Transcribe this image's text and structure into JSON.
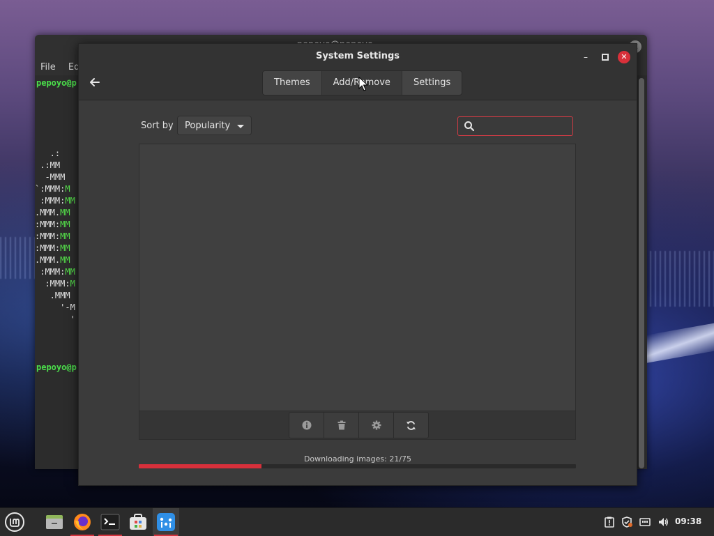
{
  "terminal": {
    "title": "pepoyo@pepoyo-...",
    "menu": [
      "File",
      "Ed"
    ],
    "prompt_top": "pepoyo@p",
    "prompt_bottom": "pepoyo@p",
    "art_lines": [
      [
        "   .:",
        ""
      ],
      [
        " .:MM",
        ""
      ],
      [
        "  -MMM",
        ""
      ],
      [
        "`:MMM:",
        "M"
      ],
      [
        " :MMM:",
        "MM"
      ],
      [
        ".MMM.",
        "MM"
      ],
      [
        ":MMM:",
        "MM"
      ],
      [
        ":MMM:",
        "MM"
      ],
      [
        ":MMM:",
        "MM"
      ],
      [
        ".MMM.",
        "MM"
      ],
      [
        " :MMM:",
        "MM"
      ],
      [
        "  :MMM:",
        "M"
      ],
      [
        "   .MMM",
        ""
      ],
      [
        "     '-M",
        ""
      ],
      [
        "       '",
        ""
      ]
    ]
  },
  "window": {
    "title": "System Settings",
    "minimize_glyph": "–",
    "maximize_glyph": "□",
    "close_glyph": "✕",
    "back_glyph": "←"
  },
  "tabs": [
    {
      "label": "Themes"
    },
    {
      "label": "Add/Remove"
    },
    {
      "label": "Settings"
    }
  ],
  "toolbar": {
    "sort_label": "Sort by",
    "sort_value": "Popularity",
    "search_value": "",
    "search_placeholder": ""
  },
  "status": {
    "text": "Downloading images: 21/75",
    "progress_fraction": 0.28
  },
  "clock": "09:38",
  "colors": {
    "accent": "#d7303b",
    "window_bg": "#3b3b3b",
    "terminal_green": "#4be04b"
  },
  "icons": {
    "info": "info-icon",
    "delete": "trash-icon",
    "configure": "gear-icon",
    "refresh": "refresh-icon"
  }
}
